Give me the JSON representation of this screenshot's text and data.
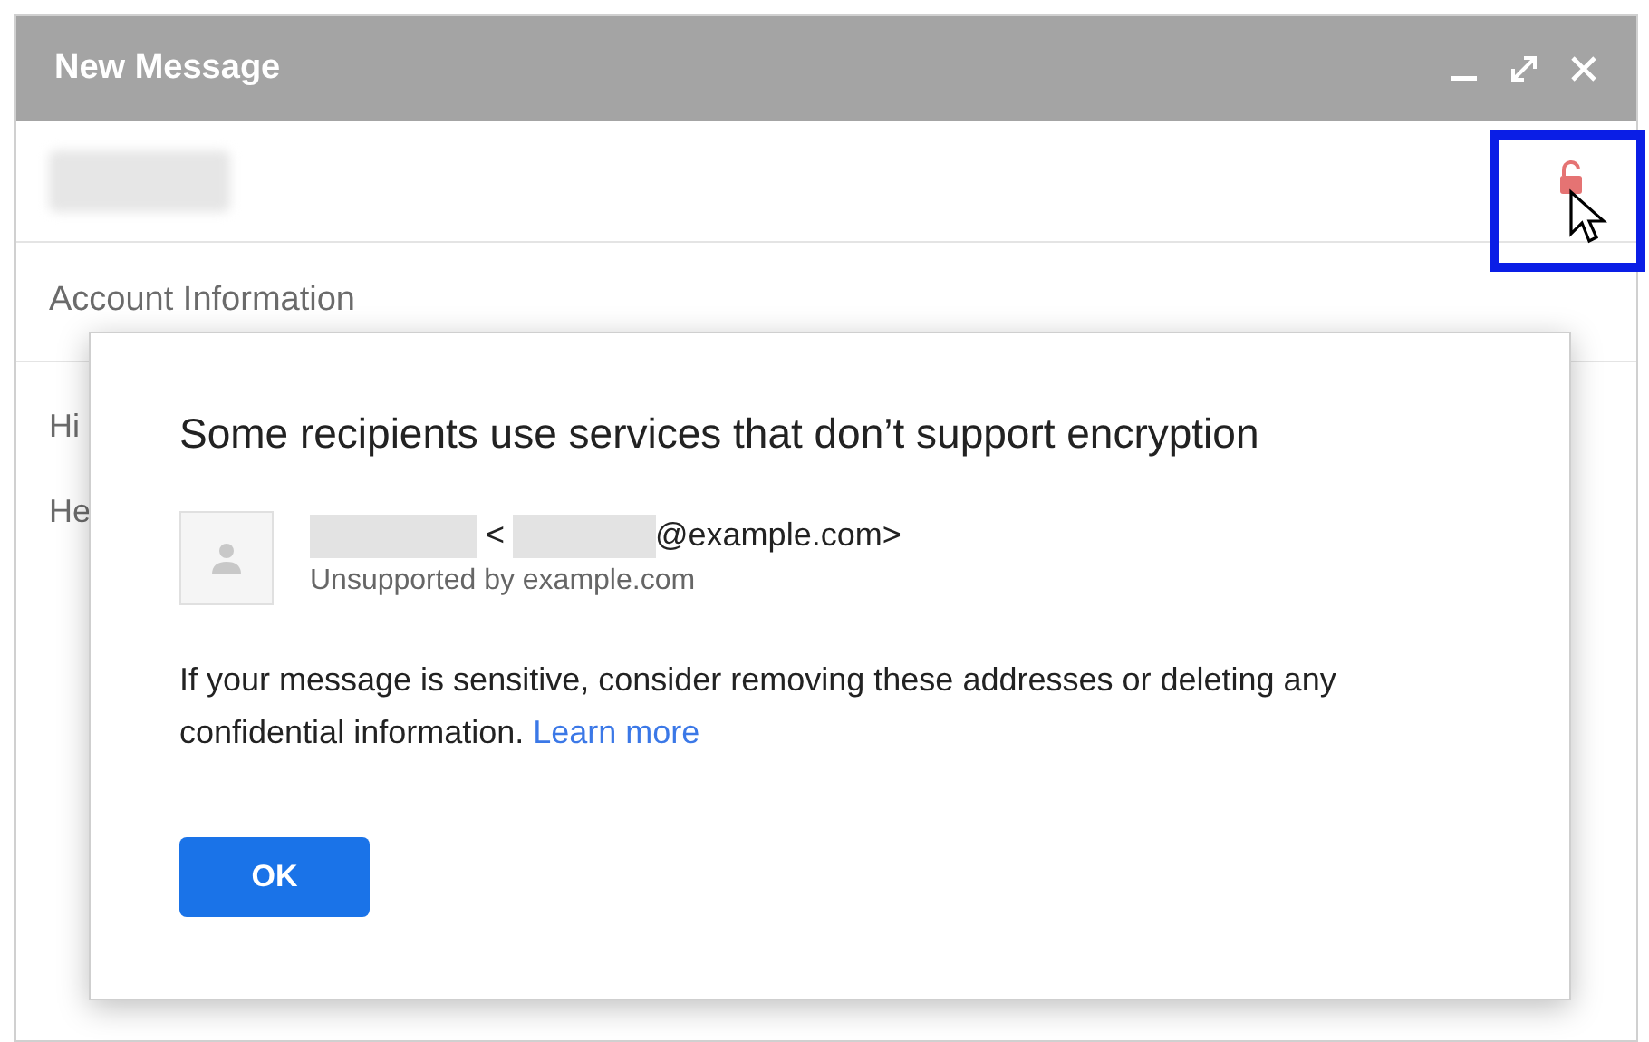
{
  "window": {
    "title": "New Message"
  },
  "compose": {
    "subject": "Account Information",
    "body_lines": [
      "Hi",
      "He"
    ],
    "encryption_locked": false,
    "lock_highlighted": true
  },
  "dialog": {
    "title": "Some recipients use services that don’t support encryption",
    "recipients": [
      {
        "open_bracket": "<",
        "address_domain": "@example.com>",
        "status": "Unsupported by example.com"
      }
    ],
    "message": "If your message is sensitive, consider removing these addresses or deleting any confidential information.",
    "link": "Learn more",
    "button": "OK"
  }
}
